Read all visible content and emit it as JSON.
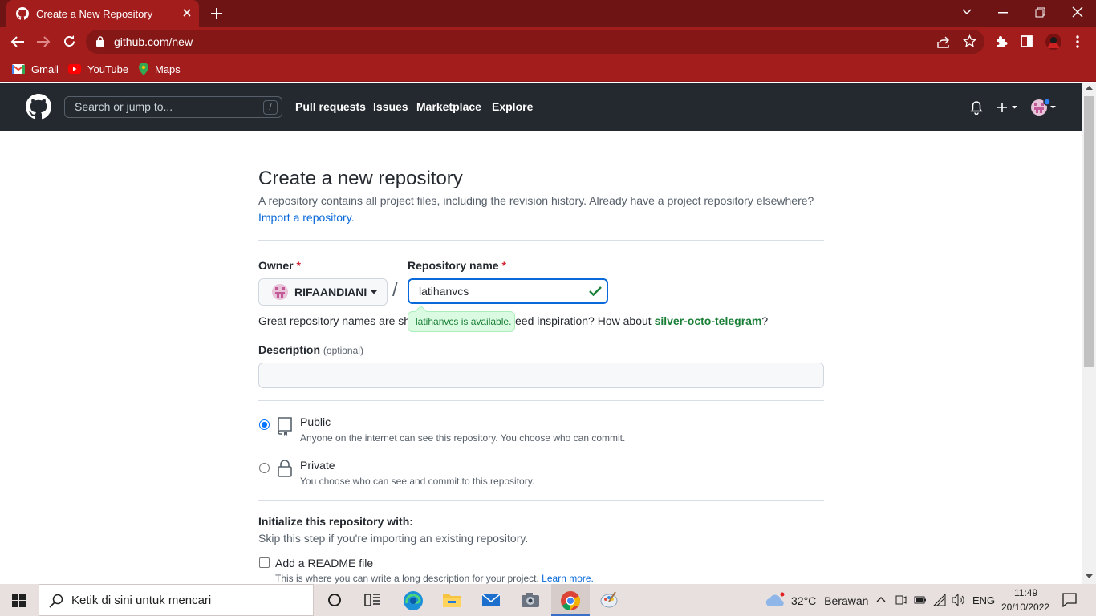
{
  "browser": {
    "tab_title": "Create a New Repository",
    "url": "github.com/new",
    "bookmarks": [
      {
        "label": "Gmail"
      },
      {
        "label": "YouTube"
      },
      {
        "label": "Maps"
      }
    ]
  },
  "github_header": {
    "search_placeholder": "Search or jump to...",
    "search_shortcut": "/",
    "nav": [
      "Pull requests",
      "Issues",
      "Marketplace",
      "Explore"
    ]
  },
  "form": {
    "title": "Create a new repository",
    "subtitle": "A repository contains all project files, including the revision history. Already have a project repository elsewhere?",
    "import_link": "Import a repository.",
    "owner_label": "Owner",
    "required_mark": "*",
    "owner_value": "RIFAANDIANI",
    "separator": "/",
    "repo_label": "Repository name",
    "repo_value": "latihanvcs",
    "availability": "latihanvcs is available.",
    "hint_start": "Great repository names are sh",
    "hint_end": "eed inspiration? How about",
    "suggestion": "silver-octo-telegram",
    "question_mark": "?",
    "description_label": "Description",
    "optional": "(optional)",
    "description_value": "",
    "visibility": [
      {
        "label": "Public",
        "desc": "Anyone on the internet can see this repository. You choose who can commit.",
        "selected": true
      },
      {
        "label": "Private",
        "desc": "You choose who can see and commit to this repository.",
        "selected": false
      }
    ],
    "init_title": "Initialize this repository with:",
    "init_sub": "Skip this step if you're importing an existing repository.",
    "readme_label": "Add a README file",
    "readme_desc": "This is where you can write a long description for your project.",
    "learn_more": "Learn more."
  },
  "taskbar": {
    "search_placeholder": "Ketik di sini untuk mencari",
    "weather_temp": "32°C",
    "weather_text": "Berawan",
    "language": "ENG",
    "time": "11:49",
    "date": "20/10/2022"
  },
  "colors": {
    "chrome_frame": "#a31d1d",
    "github_header": "#24292f",
    "link": "#0969da",
    "success": "#1a7f37"
  }
}
